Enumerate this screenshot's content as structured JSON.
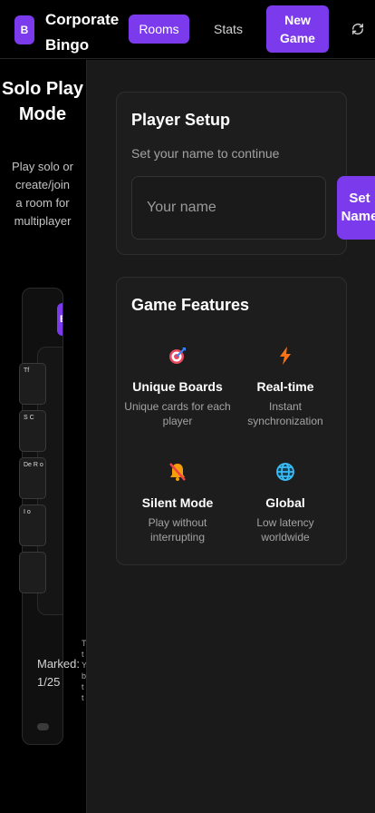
{
  "header": {
    "logo_letter": "B",
    "app_title": "Corporate Bingo",
    "rooms_label": "Rooms",
    "stats_label": "Stats",
    "new_game_label": "New Game",
    "refresh_icon": "refresh-icon"
  },
  "sidebar": {
    "title": "Solo Play Mode",
    "description": "Play solo or create/join a room for multiplayer",
    "pill_1": "B",
    "pill_2": "",
    "cells": [
      "Tf",
      "S C",
      "De R o",
      "I o",
      ""
    ],
    "marked_text": "Marked:\n1/25",
    "faded_text": "T\nt\nY\nb\nt\nt"
  },
  "setup": {
    "title": "Player Setup",
    "subtitle": "Set your name to continue",
    "name_placeholder": "Your name",
    "name_value": "",
    "set_name_label": "Set Name"
  },
  "features": {
    "title": "Game Features",
    "items": [
      {
        "icon": "target-icon",
        "title": "Unique Boards",
        "desc": "Unique cards for each player"
      },
      {
        "icon": "lightning-icon",
        "title": "Real-time",
        "desc": "Instant synchronization"
      },
      {
        "icon": "muted-bell-icon",
        "title": "Silent Mode",
        "desc": "Play without interrupting"
      },
      {
        "icon": "globe-icon",
        "title": "Global",
        "desc": "Low latency worldwide"
      }
    ]
  },
  "colors": {
    "accent": "#7c3aed",
    "background": "#000000",
    "panel": "#1d1d1d"
  }
}
